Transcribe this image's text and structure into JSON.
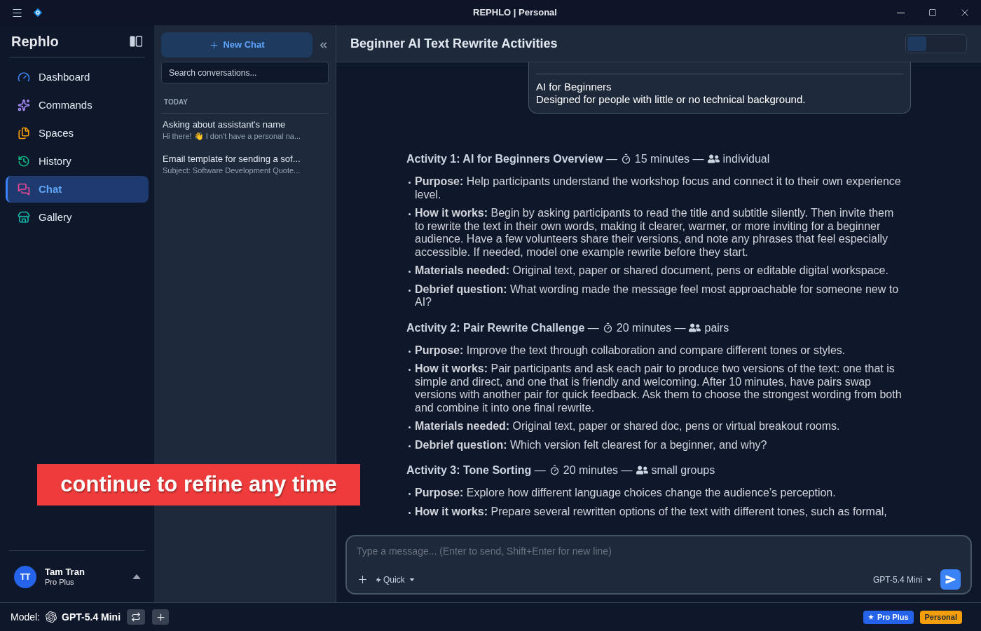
{
  "window": {
    "title": "REPHLO | Personal"
  },
  "sidebar": {
    "brand": "Rephlo",
    "items": [
      {
        "label": "Dashboard",
        "selected": false
      },
      {
        "label": "Commands",
        "selected": false
      },
      {
        "label": "Spaces",
        "selected": false
      },
      {
        "label": "History",
        "selected": false
      },
      {
        "label": "Chat",
        "selected": true
      },
      {
        "label": "Gallery",
        "selected": false
      }
    ],
    "user": {
      "initials": "TT",
      "name": "Tam Tran",
      "plan": "Pro Plus"
    }
  },
  "conversations": {
    "new_chat": "New Chat",
    "search": {
      "placeholder": "Search conversations..."
    },
    "groups": [
      {
        "label": "TODAY",
        "items": [
          {
            "title": "Asking about assistant's name",
            "preview": "Hi there! 👋 I don't have a personal na...",
            "selected": false
          },
          {
            "title": "Email template for sending a sof...",
            "preview": "Subject: Software Development Quote...",
            "selected": false
          }
        ]
      }
    ]
  },
  "chat": {
    "title": "Beginner AI Text Rewrite Activities",
    "view_toggle": {
      "on": false
    },
    "message": {
      "lines": [
        "AI for Beginners",
        "Designed for people with little or no technical background."
      ]
    },
    "activities": [
      {
        "title": "**Activity 1: AI for Beginners Overview** —",
        "duration": "15 minutes —",
        "group": "individual",
        "points": [
          "**Purpose:** Help participants understand the workshop focus and connect it to their own experience level.",
          "**How it works:** Begin by asking participants to read the title and subtitle silently. Then invite them to rewrite the text in their own words, making it clearer, warmer, or more inviting for a beginner audience. Have a few volunteers share their versions, and note any phrases that feel especially accessible. If needed, model one example rewrite before they start.",
          "**Materials needed:** Original text, paper or shared document, pens or editable digital workspace.",
          "**Debrief question:** What wording made the message feel most approachable for someone new to AI?"
        ]
      },
      {
        "title": "**Activity 2: Pair Rewrite Challenge** —",
        "duration": "20 minutes —",
        "group": "pairs",
        "points": [
          "**Purpose:** Improve the text through collaboration and compare different tones or styles.",
          "**How it works:** Pair participants and ask each pair to produce two versions of the text: one that is simple and direct, and one that is friendly and welcoming. After 10 minutes, have pairs swap versions with another pair for quick feedback. Ask them to choose the strongest wording from both and combine it into one final rewrite.",
          "**Materials needed:** Original text, paper or shared doc, pens or virtual breakout rooms.",
          "**Debrief question:** Which version felt clearest for a beginner, and why?"
        ]
      },
      {
        "title": "**Activity 3: Tone Sorting** —",
        "duration": "20 minutes —",
        "group": "small groups",
        "points": [
          "**Purpose:** Explore how different language choices change the audience’s perception.",
          "**How it works:** Prepare several rewritten options of the text with different tones, such as formal,"
        ]
      }
    ],
    "composer": {
      "placeholder": "Type a message... (Enter to send, Shift+Enter for new line)",
      "mode": "Quick",
      "model": "GPT-5.4 Mini"
    }
  },
  "caption": "continue to refine any time",
  "status_bar": {
    "label": "Model:",
    "model": "GPT-5.4 Mini",
    "badges": [
      {
        "kind": "plan",
        "label": "Pro Plus",
        "color": "#2563eb"
      },
      {
        "kind": "workspace",
        "label": "Personal",
        "color": "#f59e0b"
      }
    ]
  }
}
